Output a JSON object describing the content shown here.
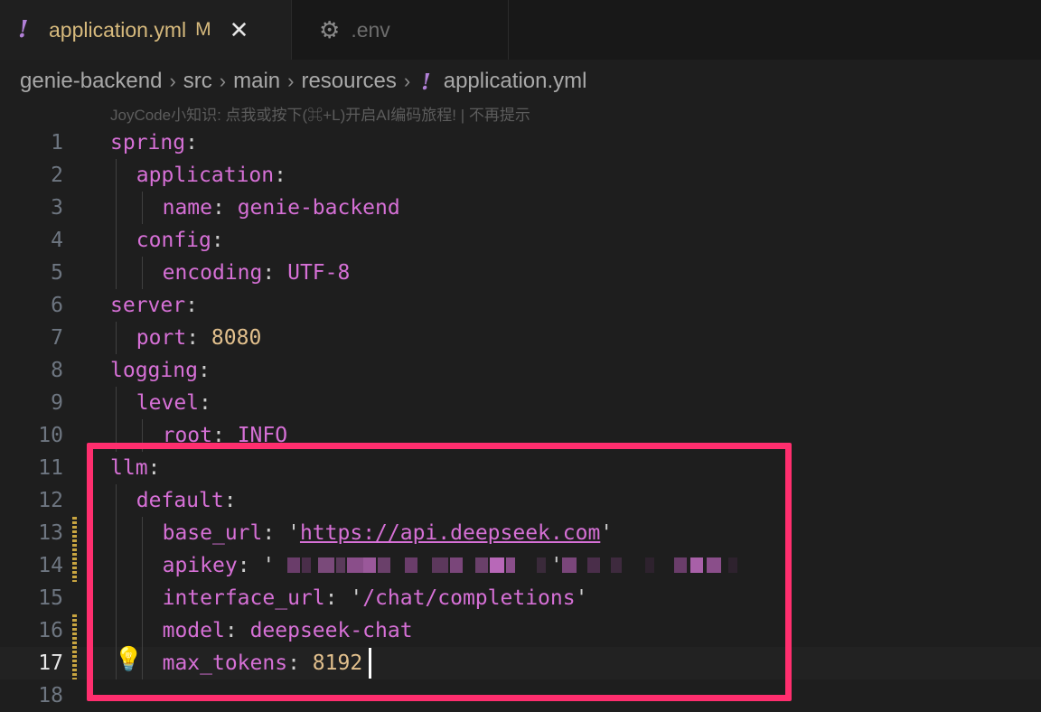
{
  "tabs": [
    {
      "label": "application.yml",
      "modified": "M",
      "icon": "yaml-exclamation-icon",
      "active": true
    },
    {
      "label": ".env",
      "icon": "gear-icon",
      "active": false
    }
  ],
  "tab_close_glyph": "✕",
  "breadcrumb": [
    "genie-backend",
    "src",
    "main",
    "resources",
    "application.yml"
  ],
  "hint": "JoyCode小知识: 点我或按下(⌘+L)开启AI编码旅程! | 不再提示",
  "lines": [
    {
      "n": "1",
      "key": "spring",
      "indent": 0
    },
    {
      "n": "2",
      "key": "application",
      "indent": 1
    },
    {
      "n": "3",
      "key": "name",
      "value": "genie-backend",
      "indent": 2
    },
    {
      "n": "4",
      "key": "config",
      "indent": 1
    },
    {
      "n": "5",
      "key": "encoding",
      "value": "UTF-8",
      "indent": 2
    },
    {
      "n": "6",
      "key": "server",
      "indent": 0
    },
    {
      "n": "7",
      "key": "port",
      "value": "8080",
      "indent": 1
    },
    {
      "n": "8",
      "key": "logging",
      "indent": 0
    },
    {
      "n": "9",
      "key": "level",
      "indent": 1
    },
    {
      "n": "10",
      "key": "root",
      "value": "INFO",
      "indent": 2
    },
    {
      "n": "11",
      "key": "llm",
      "indent": 0
    },
    {
      "n": "12",
      "key": "default",
      "indent": 1
    },
    {
      "n": "13",
      "key": "base_url",
      "value": "https://api.deepseek.com",
      "indent": 2
    },
    {
      "n": "14",
      "key": "apikey",
      "value": "",
      "indent": 2
    },
    {
      "n": "15",
      "key": "interface_url",
      "value": "/chat/completions",
      "indent": 2
    },
    {
      "n": "16",
      "key": "model",
      "value": "deepseek-chat",
      "indent": 2
    },
    {
      "n": "17",
      "key": "max_tokens",
      "value": "8192",
      "indent": 2
    },
    {
      "n": "18",
      "indent": 0
    }
  ],
  "colors": {
    "key": "#d670d6",
    "number": "#e2c08d",
    "highlight": "#ff2e6e",
    "bulb": "#ffcc00"
  },
  "current_line": "17"
}
